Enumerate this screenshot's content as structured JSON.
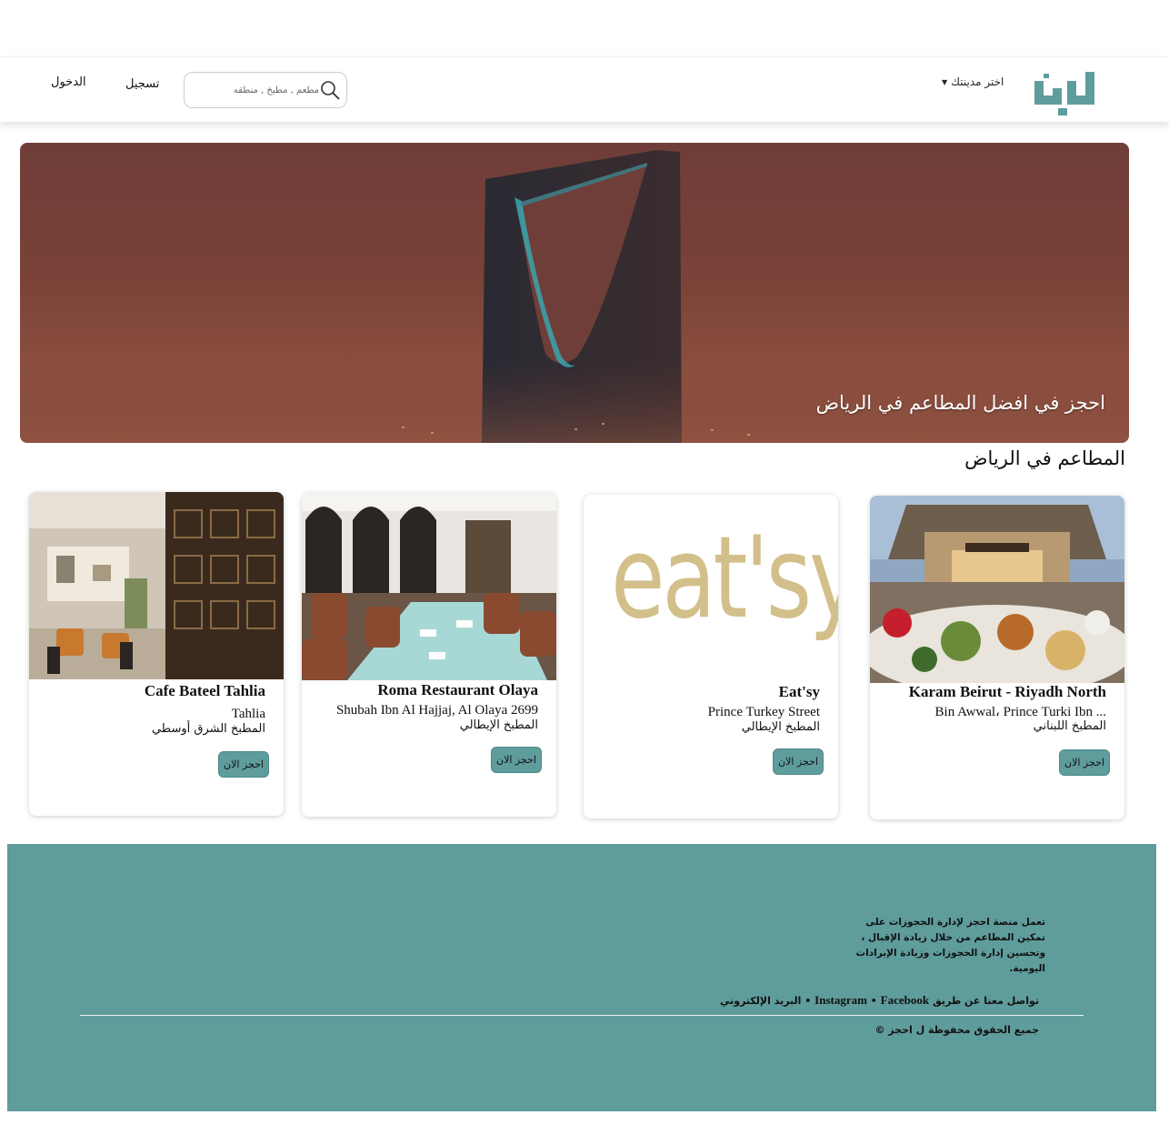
{
  "brand": {
    "logo_text": "احجز",
    "accent_color": "#5f9c9c"
  },
  "header": {
    "city_select_label": "اختر مدينتك",
    "search_placeholder": "مطعم , مطبخ , منطقه",
    "register_label": "تسجيل",
    "login_label": "الدخول"
  },
  "hero": {
    "caption": "احجز في افضل المطاعم في الرياض"
  },
  "section": {
    "title": "المطاعم في الرياض"
  },
  "restaurants": [
    {
      "name": "Karam Beirut - Riyadh North",
      "address": "Bin Awwal، Prince Turki Ibn ...",
      "cuisine": "المطبخ اللبناني",
      "button": "احجز الان",
      "image": "restaurant-terrace-food-photo"
    },
    {
      "name": "Eat'sy",
      "address": "Prince Turkey Street",
      "cuisine": "المطبخ الإيطالي",
      "button": "احجز الان",
      "image": "eatsy-logo",
      "logo_text": "eat'sy"
    },
    {
      "name": "Roma Restaurant Olaya",
      "address": "Shubah Ibn Al Hajjaj, Al Olaya 2699",
      "cuisine": "المطبخ الإيطالي",
      "button": "احجز الان",
      "image": "restaurant-dining-hall-photo"
    },
    {
      "name": "Cafe Bateel Tahlia",
      "address": "Tahlia",
      "cuisine": "المطبخ الشرق أوسطي",
      "button": "احجز الان",
      "image": "cafe-interior-screens-photo"
    }
  ],
  "footer": {
    "about_line1": "تعمل منصة احجز لإدارة الحجوزات على",
    "about_line2": "تمكين المطاعم من خلال زيادة الإقبال ،",
    "about_line3": "وتحسين إدارة الحجوزات وزيادة الإيرادات اليومية.",
    "contact_prefix": "تواصل معنا عن طريق",
    "contact_links": [
      "Instagram",
      "Facebook",
      "البريد الإلكتروني"
    ],
    "separator": "•",
    "copyright": "جميع الحقوق محفوظة ل احجز ©"
  }
}
